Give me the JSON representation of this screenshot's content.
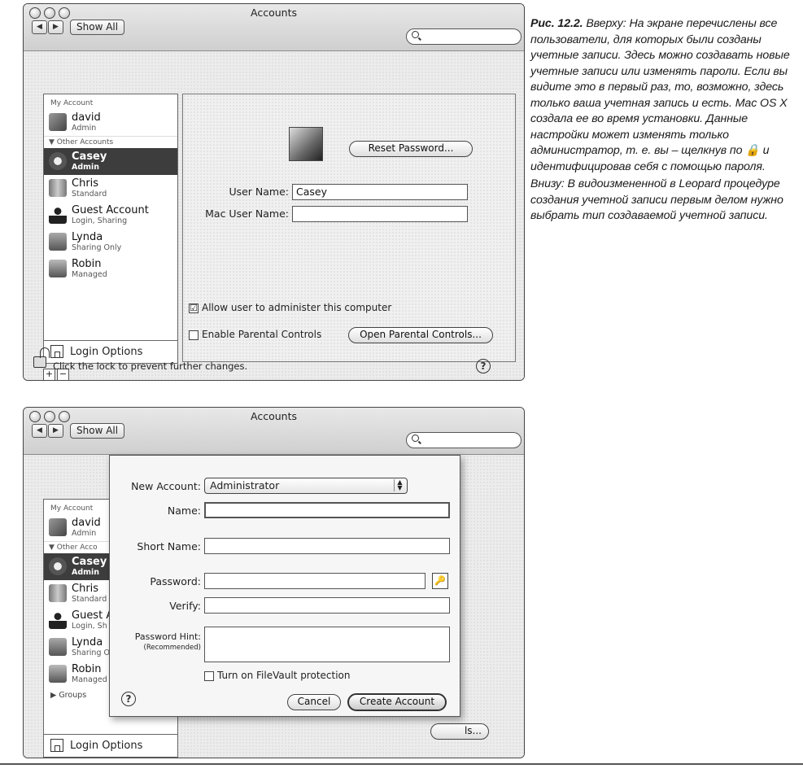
{
  "caption": {
    "figure_label": "Рис. 12.2.",
    "paragraph1": "Вверху: На экране перечислены все пользователи, для которых были созданы учетные записи. Здесь можно создавать новые учетные записи или изменять пароли. Если вы видите это в первый раз, то, возможно, здесь только ваша учетная запись и есть. Mac OS X создала ее во время установки. Данные настройки может изменять только администратор, т. е. вы – щелкнув по 🔒 и идентифицировав себя с помощью пароля.",
    "paragraph2": "Внизу: В видоизмененной в Leopard процедуре создания учетной записи первым делом нужно выбрать тип создаваемой учетной записи."
  },
  "top_window": {
    "title": "Accounts",
    "back_label": "◀",
    "forward_label": "▶",
    "show_all_label": "Show All",
    "search_placeholder": "",
    "sidebar": {
      "my_account_header": "My Account",
      "my_account": {
        "name": "david",
        "role": "Admin"
      },
      "other_header": "▼ Other Accounts",
      "accounts": [
        {
          "name": "Casey",
          "role": "Admin"
        },
        {
          "name": "Chris",
          "role": "Standard"
        },
        {
          "name": "Guest Account",
          "role": "Login, Sharing"
        },
        {
          "name": "Lynda",
          "role": "Sharing Only"
        },
        {
          "name": "Robin",
          "role": "Managed"
        }
      ],
      "login_options_label": "Login Options",
      "add_label": "+",
      "remove_label": "−"
    },
    "detail": {
      "reset_password_label": "Reset Password...",
      "user_name_label": "User Name:",
      "user_name_value": "Casey",
      "mac_user_name_label": "Mac User Name:",
      "mac_user_name_value": "",
      "allow_admin_label": "Allow user to administer this computer",
      "allow_admin_checked": "☑",
      "parental_controls_label": "Enable Parental Controls",
      "open_parental_label": "Open Parental Controls..."
    },
    "lock_text": "Click the lock to prevent further changes.",
    "help_label": "?"
  },
  "bottom_window": {
    "title": "Accounts",
    "back_label": "◀",
    "forward_label": "▶",
    "show_all_label": "Show All",
    "sidebar": {
      "my_account_header": "My Account",
      "my_account": {
        "name": "david",
        "role": "Admin"
      },
      "other_header": "▼ Other Acco",
      "accounts": [
        {
          "name": "Casey",
          "role": "Admin"
        },
        {
          "name": "Chris",
          "role": "Standard"
        },
        {
          "name": "Guest A",
          "role": "Login, Sh"
        },
        {
          "name": "Lynda",
          "role": "Sharing O"
        },
        {
          "name": "Robin",
          "role": "Managed"
        }
      ],
      "groups_label": "▶ Groups",
      "login_options_label": "Login Options"
    },
    "behind_button_label": "ls...",
    "sheet": {
      "new_account_label": "New Account:",
      "new_account_value": "Administrator",
      "name_label": "Name:",
      "short_name_label": "Short Name:",
      "password_label": "Password:",
      "key_label": "🔑",
      "verify_label": "Verify:",
      "hint_label": "Password Hint:",
      "hint_sub_label": "(Recommended)",
      "filevault_label": "Turn on FileVault protection",
      "help_label": "?",
      "cancel_label": "Cancel",
      "create_label": "Create Account"
    }
  }
}
